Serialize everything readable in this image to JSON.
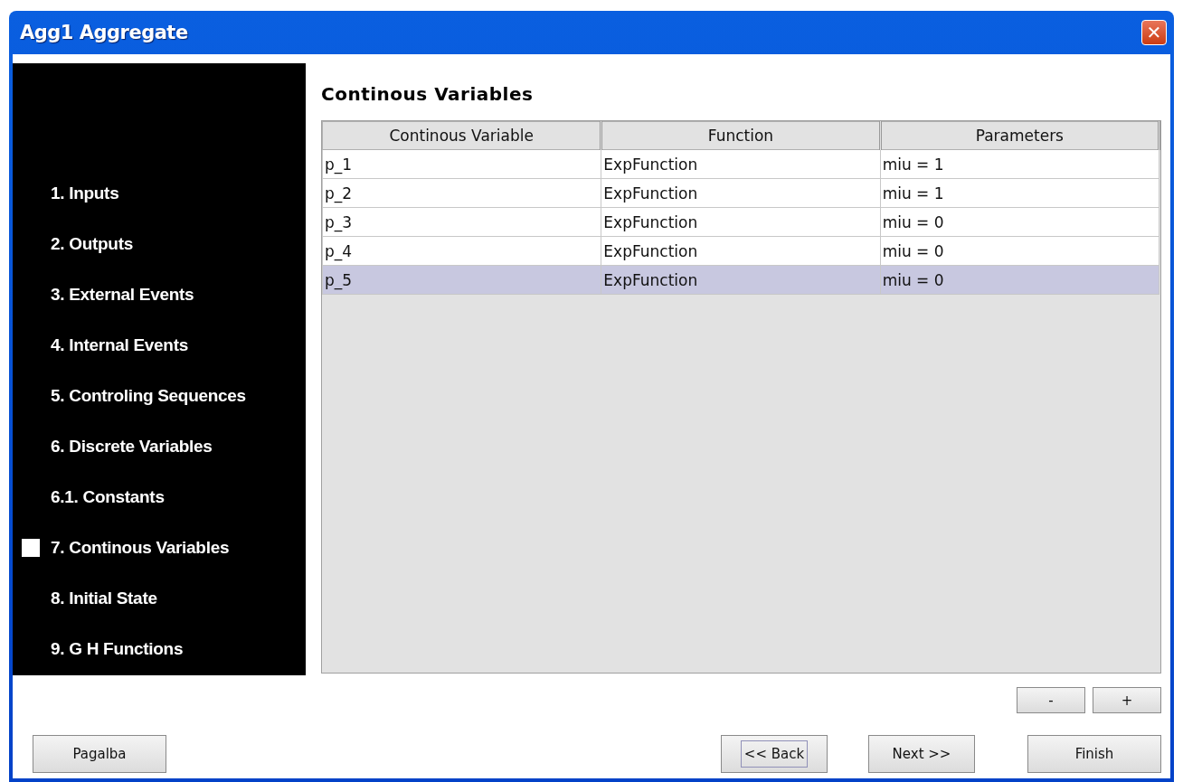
{
  "window": {
    "title": "Agg1 Aggregate",
    "close": "✕"
  },
  "steps": [
    {
      "label": "1. Inputs",
      "selected": false
    },
    {
      "label": "2. Outputs",
      "selected": false
    },
    {
      "label": "3. External Events",
      "selected": false
    },
    {
      "label": "4. Internal Events",
      "selected": false
    },
    {
      "label": "5. Controling Sequences",
      "selected": false
    },
    {
      "label": "6. Discrete Variables",
      "selected": false
    },
    {
      "label": "6.1. Constants",
      "selected": false
    },
    {
      "label": "7. Continous Variables",
      "selected": true
    },
    {
      "label": "8. Initial State",
      "selected": false
    },
    {
      "label": "9. G H Functions",
      "selected": false
    }
  ],
  "page_title": "Continous Variables",
  "table": {
    "columns": [
      "Continous Variable",
      "Function",
      "Parameters"
    ],
    "rows": [
      {
        "cells": [
          "p_1",
          "ExpFunction",
          "miu = 1"
        ],
        "selected": false
      },
      {
        "cells": [
          "p_2",
          "ExpFunction",
          "miu = 1"
        ],
        "selected": false
      },
      {
        "cells": [
          "p_3",
          "ExpFunction",
          "miu = 0"
        ],
        "selected": false
      },
      {
        "cells": [
          "p_4",
          "ExpFunction",
          "miu = 0"
        ],
        "selected": false
      },
      {
        "cells": [
          "p_5",
          "ExpFunction",
          "miu = 0"
        ],
        "selected": true
      }
    ]
  },
  "row_buttons": [
    "-",
    "+"
  ],
  "help_button": "Pagalba",
  "nav_buttons": [
    {
      "label": "<< Back",
      "focused": true
    },
    {
      "label": "Next >>",
      "focused": false
    },
    {
      "label": "Finish",
      "focused": false
    }
  ]
}
